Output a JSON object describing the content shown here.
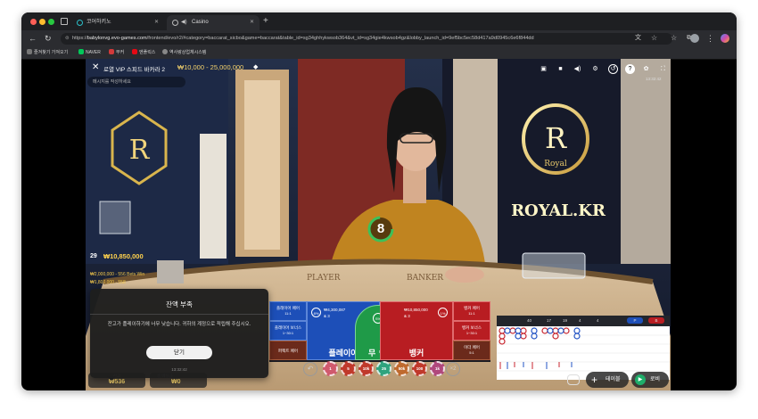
{
  "browser": {
    "tabs": [
      {
        "label": "코어하키노",
        "active": false
      },
      {
        "label": "Casino",
        "active": true
      }
    ],
    "new_tab": "+",
    "url_prefix": "https://",
    "url_host": "babylonvg.evo-games.com",
    "url_path": "/frontend/evo/r2/#category=baccarat_sicbo&game=baccarat&table_id=sg34ghhykwsob364&vt_id=sg34gie4kwsob4gz&lobby_launch_id=9ef5bc5ec58d417a9d0945c6e6f844dd",
    "bookmarks": [
      "즐겨찾기 가져오기",
      "NAVER",
      "부커",
      "엔플릭스",
      "역사랑상업체시스템"
    ]
  },
  "game": {
    "table_title": "로열 VIP 스피드 바카라 2",
    "limits": "₩10,000 - 25,000,000",
    "chat_placeholder": "메시지를 작성하세요",
    "time_top": "13:32:42",
    "timer": "8",
    "players_count": "29",
    "total_bet": "₩10,850,000",
    "side_bet_1": "₩2,000,000 - 556 Bets Win",
    "side_bet_2": "₩1,800,000 - 558",
    "table_banner": "ROYAL.KR",
    "felt_player": "PLAYER",
    "felt_banker": "BANKER",
    "crest_letter": "R",
    "crest_word": "Royal"
  },
  "dialog": {
    "title": "잔액 부족",
    "message": "잔고가 플레이하기에 너무 낮습니다. 귀하의 계정으로 적립해 주십시오.",
    "button": "닫기",
    "time": "13:32:42"
  },
  "bets": {
    "player_pair": "플레이어 페어",
    "player_pair_odds": "11:1",
    "player_bonus": "플레이어 보너스",
    "player_bonus_odds": "1~30:1",
    "perfect_pair": "퍼펙트 페어",
    "player": "플레이어",
    "player_amount": "₩4,300,087",
    "player_count": "& 3",
    "tie": "무",
    "tie_odds": "8:1",
    "tie_stat": "S%",
    "banker": "뱅커",
    "banker_amount": "₩10,850,000",
    "banker_count": "& 3",
    "banker_pair": "뱅커 페어",
    "banker_pair_odds": "11:1",
    "banker_bonus": "뱅커 보너스",
    "banker_bonus_odds": "1~30:1",
    "either_pair": "이더 페어",
    "either_pair_odds": "5:1",
    "player_pct": "8%",
    "banker_pct": "1%"
  },
  "chips": [
    "1",
    "5",
    "10k",
    "25",
    "50k",
    "100",
    "1k"
  ],
  "chip_more": "×2",
  "roadmap": {
    "stats": [
      "40",
      "17",
      "19",
      "4",
      "4"
    ],
    "label_p": "P",
    "label_b": "B"
  },
  "footer": {
    "balance_label": "잔고",
    "balance_value": "₩536",
    "total_bet_label": "총 베팅금",
    "total_bet_value": "₩0",
    "table_button": "테이블",
    "lobby_button": "로비"
  },
  "colors": {
    "player_blue": "#1d4fb8",
    "banker_red": "#b81d22",
    "tie_green": "#1f9a48",
    "timer_green": "#3cc15a",
    "gold": "#e6c66a"
  }
}
